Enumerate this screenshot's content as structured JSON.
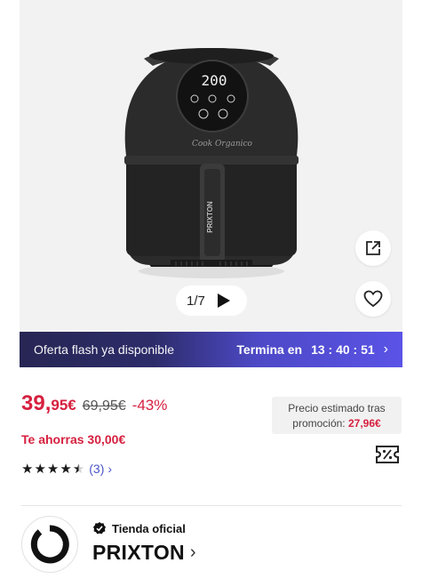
{
  "gallery": {
    "counter": "1/7",
    "product_brand_text": "PRIXTON",
    "product_script_text": "Cook Organico",
    "display_value": "200"
  },
  "flash": {
    "label": "Oferta flash ya disponible",
    "timer_prefix": "Termina en",
    "time": "13 : 40 : 51"
  },
  "price": {
    "current_int": "39,",
    "current_dec": "95€",
    "original": "69,95€",
    "discount": "-43%",
    "savings": "Te ahorras 30,00€",
    "estimate_label": "Precio estimado tras",
    "estimate_label_2": "promoción:",
    "estimate_value": "27,96€"
  },
  "rating": {
    "stars": 4.5,
    "count": "(3)"
  },
  "store": {
    "badge": "Tienda oficial",
    "name": "PRIXTON"
  },
  "colors": {
    "accent_red": "#d6203f",
    "flash_dark": "#272654",
    "flash_light": "#5a53e6",
    "link_blue": "#4a55c8"
  }
}
